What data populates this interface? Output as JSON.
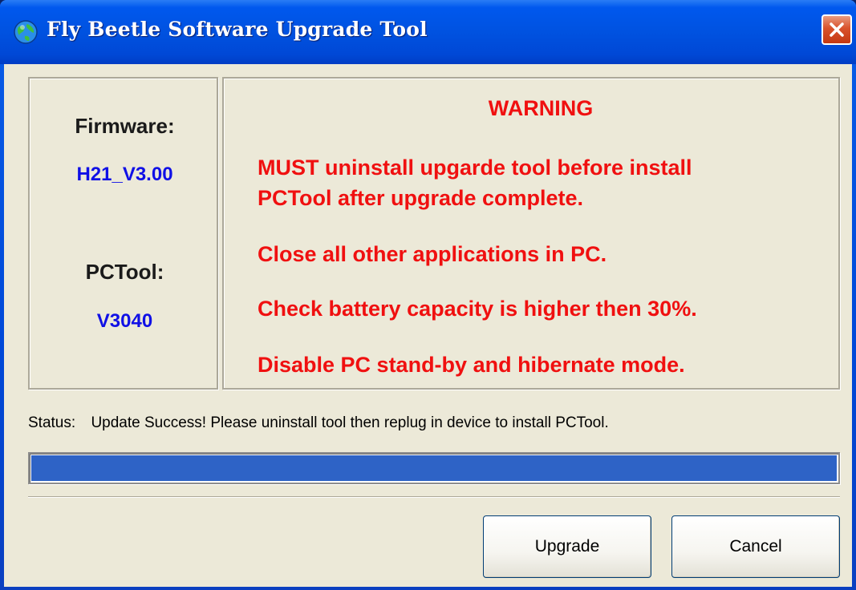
{
  "window": {
    "title": "Fly Beetle Software Upgrade Tool",
    "icon": "globe-icon",
    "close_icon": "close-icon"
  },
  "info_panel": {
    "firmware_label": "Firmware:",
    "firmware_value": "H21_V3.00",
    "pctool_label": "PCTool:",
    "pctool_value": "V3040"
  },
  "warning_panel": {
    "title": "WARNING",
    "lines": [
      "MUST uninstall upgarde tool before install",
      "PCTool after upgrade complete.",
      "Close all other applications in PC.",
      "Check battery capacity is higher then 30%.",
      "Disable PC stand-by and hibernate mode."
    ]
  },
  "status": {
    "label": "Status:",
    "text": "Update Success! Please uninstall tool then replug in device to install PCTool."
  },
  "progress": {
    "fraction": 1.0
  },
  "buttons": {
    "upgrade_label": "Upgrade",
    "cancel_label": "Cancel"
  },
  "colors": {
    "titlebar": "#0052e0",
    "client_bg": "#ece9d8",
    "warning_text": "#f01010",
    "value_text": "#1010e6",
    "progress_fill": "#2e63c6"
  }
}
